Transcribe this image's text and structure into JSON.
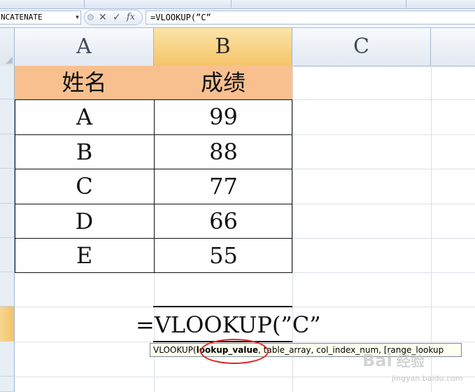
{
  "formula_bar": {
    "name_box": "NCATENATE",
    "cancel_symbol": "✕",
    "enter_symbol": "✓",
    "fx_label": "fx",
    "formula": "=VLOOKUP(”C”"
  },
  "columns": [
    "A",
    "B",
    "C"
  ],
  "table": {
    "headers": [
      "姓名",
      "成绩"
    ],
    "rows": [
      {
        "name": "A",
        "score": "99"
      },
      {
        "name": "B",
        "score": "88"
      },
      {
        "name": "C",
        "score": "77"
      },
      {
        "name": "D",
        "score": "66"
      },
      {
        "name": "E",
        "score": "55"
      }
    ]
  },
  "active_cell": {
    "content": "=VLOOKUP(”C”"
  },
  "tooltip": {
    "function": "VLOOKUP(",
    "current_arg": "lookup_value",
    "rest": ", table_array, col_index_num, [range_lookup"
  },
  "watermark": {
    "brand": "Bai",
    "brand2": "经验",
    "sub": "jingyan.baidu.com"
  },
  "colors": {
    "header_fill": "#f9c08f",
    "active_col_header": "#f5c468",
    "annotation_circle": "#e02020"
  }
}
